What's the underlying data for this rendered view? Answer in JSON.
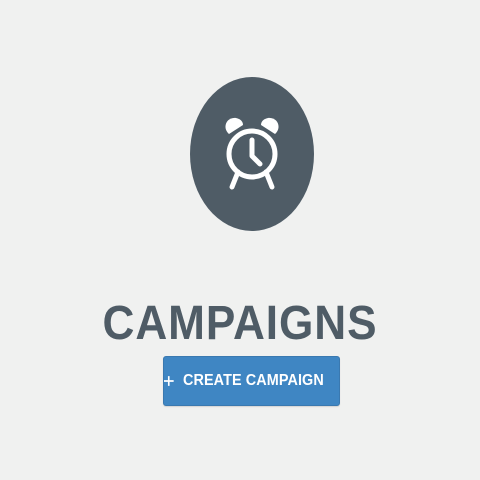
{
  "page": {
    "title": "CAMPAIGNS",
    "icon": "alarm-clock-icon"
  },
  "actions": {
    "create_campaign_label": "CREATE CAMPAIGN",
    "create_campaign_icon": "plus-icon"
  },
  "colors": {
    "background": "#f0f1f0",
    "icon_circle": "#4f5c66",
    "title_text": "#4f5c66",
    "button_background": "#3f86c3",
    "button_text": "#ffffff"
  }
}
